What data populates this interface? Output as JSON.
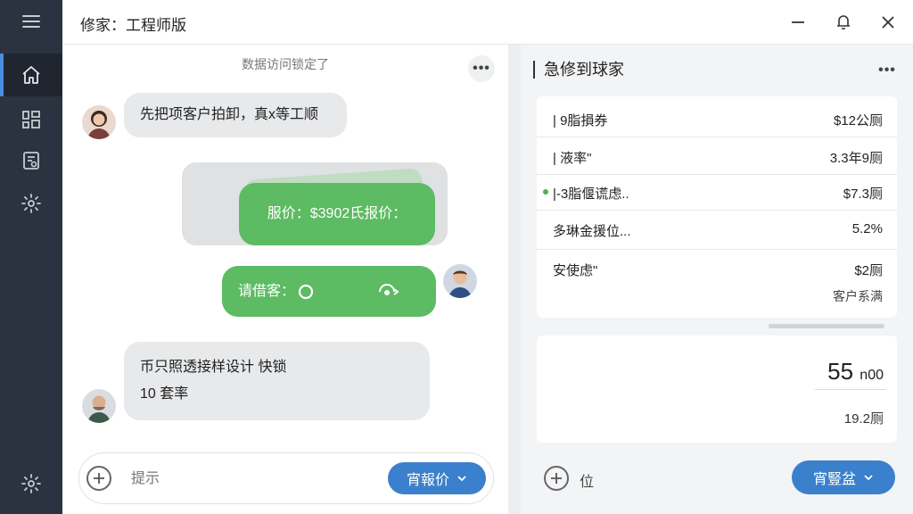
{
  "app": {
    "title": "修家：工程师版"
  },
  "colors": {
    "accent": "#3a80cc",
    "bubble_green": "#5dbb63",
    "sidebar": "#2b3340",
    "status_dot": "#4cb050"
  },
  "sidebar": {
    "items": [
      {
        "icon": "menu-icon"
      },
      {
        "icon": "home-icon",
        "active": true
      },
      {
        "icon": "grid-icon"
      },
      {
        "icon": "report-icon"
      },
      {
        "icon": "gear-icon"
      }
    ],
    "footer_icon": "gear-icon"
  },
  "window": {
    "icons": [
      "minimize-icon",
      "bell-icon",
      "close-icon"
    ]
  },
  "chat": {
    "header": "数据访问锁定了",
    "more": "•••",
    "messages": [
      {
        "from": "customer",
        "text": "先把项客户拍卸，真x等工顺"
      },
      {
        "from": "engineer",
        "text": "服价：$3902氏报价："
      },
      {
        "from": "engineer",
        "text": "请借客："
      },
      {
        "from": "customer2",
        "line1": "币只照透接样设计 快锁",
        "line2": "10 套率"
      }
    ],
    "composer": {
      "placeholder": "提示",
      "send_label": "宵報价"
    }
  },
  "panel": {
    "title": "急修到球家",
    "more": "•••",
    "rows": [
      {
        "label": "|  9脂損券",
        "value": "$12公厕"
      },
      {
        "label": "|  液率\"",
        "value": "3.3年9厕"
      },
      {
        "label": "|-3脂偃谎虑..",
        "value": "$7.3厕",
        "dot": true
      },
      {
        "label": "多琳金援位...",
        "value": "5.2%"
      },
      {
        "label": "安使虑\"",
        "value": "$2厕"
      }
    ],
    "sub_note": "客户系满",
    "summary": {
      "big_value": "55",
      "big_unit": "n00",
      "small_value": "19.2厕"
    },
    "footer": {
      "input_label": "位",
      "action_label": "宵豎盆"
    }
  }
}
